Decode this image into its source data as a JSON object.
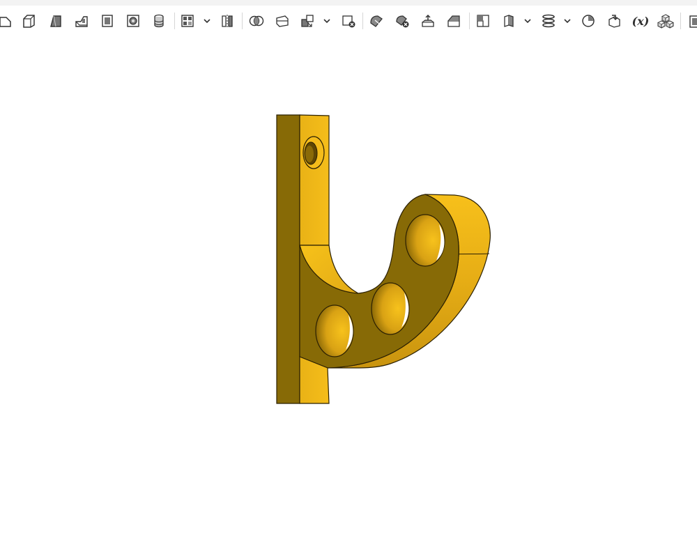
{
  "toolbar": {
    "variables_label": "(x)",
    "tools": [
      "sketch-icon",
      "extrude-icon",
      "revolve-icon",
      "sweep-icon",
      "loft-icon",
      "thicken-icon",
      "hole-icon",
      "pattern-icon",
      "mirror-icon",
      "boolean-icon",
      "split-icon",
      "transform-icon",
      "delete-part-icon",
      "modify-fillet-icon",
      "delete-face-icon",
      "move-face-icon",
      "replace-face-icon",
      "plane-icon",
      "sheet-metal-icon",
      "helix-icon",
      "mate-connector-icon",
      "derived-icon",
      "variable-icon",
      "assembly-icon",
      "more-icon"
    ]
  },
  "model": {
    "part_name": "bracket-hook",
    "colors": {
      "face_light": "#f2b816",
      "face_mid": "#d7a214",
      "face_dark": "#876a06",
      "edge": "#2b2003",
      "hole_inner": "#5e4604"
    }
  }
}
